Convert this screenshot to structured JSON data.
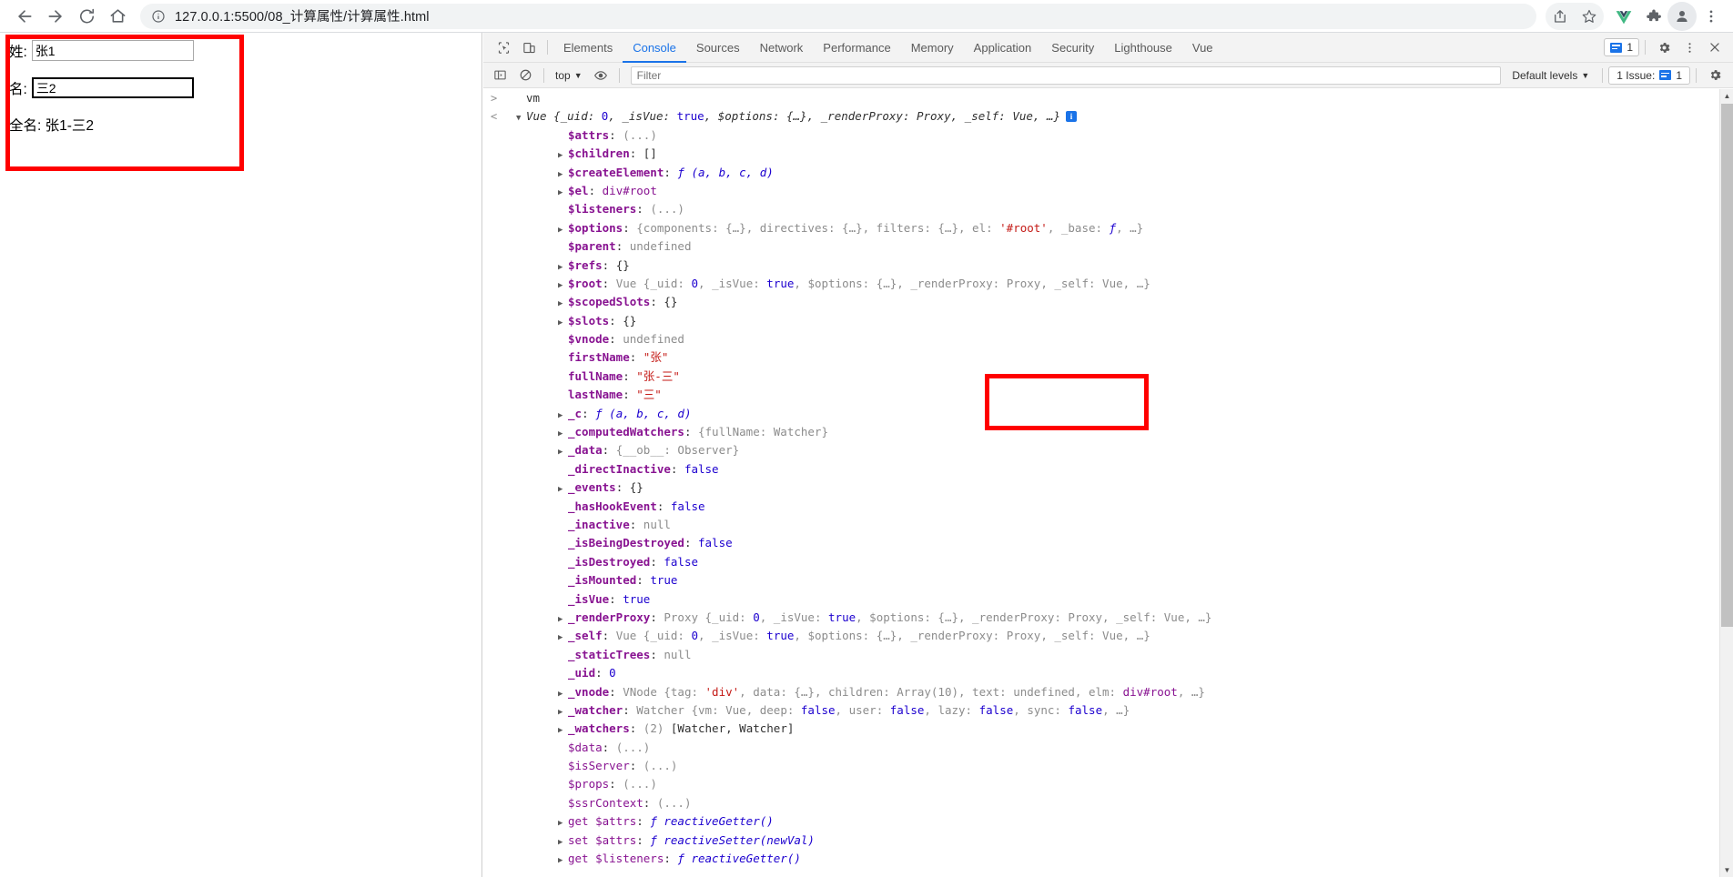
{
  "browser": {
    "nav": {
      "back": "back-arrow",
      "forward": "forward-arrow",
      "reload": "reload",
      "home": "home"
    },
    "omnibox": {
      "info_icon": "info-circle-icon",
      "url": "127.0.0.1:5500/08_计算属性/计算属性.html"
    },
    "actions": [
      "share-icon",
      "bookmark-star-icon"
    ],
    "extensions": [
      "vue-devtools-icon",
      "puzzle-extensions-icon",
      "profile-avatar-icon",
      "chrome-menu-icon"
    ]
  },
  "page": {
    "fields": [
      {
        "label": "姓:",
        "value": "张1",
        "focused": false
      },
      {
        "label": "名:",
        "value": "三2",
        "focused": true
      }
    ],
    "fullname_line": "全名: 张1-三2",
    "highlight_color": "#ff0000"
  },
  "devtools": {
    "toolbar_icons": [
      "inspect-element-icon",
      "device-toolbar-icon"
    ],
    "tabs": [
      {
        "label": "Elements",
        "active": false
      },
      {
        "label": "Console",
        "active": true
      },
      {
        "label": "Sources",
        "active": false
      },
      {
        "label": "Network",
        "active": false
      },
      {
        "label": "Performance",
        "active": false
      },
      {
        "label": "Memory",
        "active": false
      },
      {
        "label": "Application",
        "active": false
      },
      {
        "label": "Security",
        "active": false
      },
      {
        "label": "Lighthouse",
        "active": false
      },
      {
        "label": "Vue",
        "active": false
      }
    ],
    "issue_badge_count": "1",
    "settings_icon": "gear-icon",
    "more_icon": "kebab-menu-icon",
    "close_icon": "close-icon",
    "filterbar": {
      "sidebar_icon": "console-sidebar-icon",
      "clear_icon": "clear-console-icon",
      "context": "top",
      "eye_icon": "live-expression-eye-icon",
      "filter_placeholder": "Filter",
      "levels": "Default levels",
      "issues_label": "1 Issue:",
      "issues_count": "1",
      "console_settings_icon": "gear-icon"
    },
    "accent_color": "#1a73e8"
  },
  "console": {
    "input_echo": "vm",
    "highlight_color": "#ff0000",
    "lines": [
      {
        "id": "l0",
        "gutter": ">",
        "arrow": "",
        "indent": 0,
        "tokens": [
          {
            "t": "vm",
            "c": "k-plain"
          }
        ]
      },
      {
        "id": "l1",
        "gutter": "<",
        "arrow": "▼",
        "indent": 0,
        "tokens": [
          {
            "t": "Vue ",
            "c": "k-vueit"
          },
          {
            "t": "{_uid: ",
            "c": "k-obj"
          },
          {
            "t": "0",
            "c": "k-num"
          },
          {
            "t": ", _isVue: ",
            "c": "k-obj"
          },
          {
            "t": "true",
            "c": "k-bool"
          },
          {
            "t": ", $options: {…}, _renderProxy: Proxy, _self: Vue, …}",
            "c": "k-obj"
          }
        ],
        "info": true
      },
      {
        "id": "l2",
        "gutter": "",
        "arrow": "",
        "indent": 1,
        "tokens": [
          {
            "t": "$attrs",
            "c": "k-prop"
          },
          {
            "t": ": ",
            "c": "k-plain"
          },
          {
            "t": "(...)",
            "c": "k-grey"
          }
        ]
      },
      {
        "id": "l3",
        "gutter": "",
        "arrow": "▶",
        "indent": 1,
        "tokens": [
          {
            "t": "$children",
            "c": "k-prop"
          },
          {
            "t": ": []",
            "c": "k-plain"
          }
        ]
      },
      {
        "id": "l4",
        "gutter": "",
        "arrow": "▶",
        "indent": 1,
        "tokens": [
          {
            "t": "$createElement",
            "c": "k-prop"
          },
          {
            "t": ": ",
            "c": "k-plain"
          },
          {
            "t": "ƒ (a, b, c, d)",
            "c": "k-fn"
          }
        ]
      },
      {
        "id": "l5",
        "gutter": "",
        "arrow": "▶",
        "indent": 1,
        "tokens": [
          {
            "t": "$el",
            "c": "k-prop"
          },
          {
            "t": ": ",
            "c": "k-plain"
          },
          {
            "t": "div#root",
            "c": "k-node"
          }
        ]
      },
      {
        "id": "l6",
        "gutter": "",
        "arrow": "",
        "indent": 1,
        "tokens": [
          {
            "t": "$listeners",
            "c": "k-prop"
          },
          {
            "t": ": ",
            "c": "k-plain"
          },
          {
            "t": "(...)",
            "c": "k-grey"
          }
        ]
      },
      {
        "id": "l7",
        "gutter": "",
        "arrow": "▶",
        "indent": 1,
        "tokens": [
          {
            "t": "$options",
            "c": "k-prop"
          },
          {
            "t": ": ",
            "c": "k-plain"
          },
          {
            "t": "{components: {…}, directives: {…}, filters: {…}, el: ",
            "c": "k-grey"
          },
          {
            "t": "'#root'",
            "c": "k-str"
          },
          {
            "t": ", _base: ",
            "c": "k-grey"
          },
          {
            "t": "ƒ",
            "c": "k-fn"
          },
          {
            "t": ", …}",
            "c": "k-grey"
          }
        ]
      },
      {
        "id": "l8",
        "gutter": "",
        "arrow": "",
        "indent": 1,
        "tokens": [
          {
            "t": "$parent",
            "c": "k-prop"
          },
          {
            "t": ": ",
            "c": "k-plain"
          },
          {
            "t": "undefined",
            "c": "k-grey"
          }
        ]
      },
      {
        "id": "l9",
        "gutter": "",
        "arrow": "▶",
        "indent": 1,
        "tokens": [
          {
            "t": "$refs",
            "c": "k-prop"
          },
          {
            "t": ": {}",
            "c": "k-plain"
          }
        ]
      },
      {
        "id": "l10",
        "gutter": "",
        "arrow": "▶",
        "indent": 1,
        "tokens": [
          {
            "t": "$root",
            "c": "k-prop"
          },
          {
            "t": ": ",
            "c": "k-plain"
          },
          {
            "t": "Vue {_uid: ",
            "c": "k-grey"
          },
          {
            "t": "0",
            "c": "k-num"
          },
          {
            "t": ", _isVue: ",
            "c": "k-grey"
          },
          {
            "t": "true",
            "c": "k-bool"
          },
          {
            "t": ", $options: {…}, _renderProxy: Proxy, _self: Vue, …}",
            "c": "k-grey"
          }
        ]
      },
      {
        "id": "l11",
        "gutter": "",
        "arrow": "▶",
        "indent": 1,
        "tokens": [
          {
            "t": "$scopedSlots",
            "c": "k-prop"
          },
          {
            "t": ": {}",
            "c": "k-plain"
          }
        ]
      },
      {
        "id": "l12",
        "gutter": "",
        "arrow": "▶",
        "indent": 1,
        "tokens": [
          {
            "t": "$slots",
            "c": "k-prop"
          },
          {
            "t": ": {}",
            "c": "k-plain"
          }
        ]
      },
      {
        "id": "l13",
        "gutter": "",
        "arrow": "",
        "indent": 1,
        "tokens": [
          {
            "t": "$vnode",
            "c": "k-prop"
          },
          {
            "t": ": ",
            "c": "k-plain"
          },
          {
            "t": "undefined",
            "c": "k-grey"
          }
        ]
      },
      {
        "id": "l14",
        "gutter": "",
        "arrow": "",
        "indent": 1,
        "tokens": [
          {
            "t": "firstName",
            "c": "k-prop"
          },
          {
            "t": ": ",
            "c": "k-plain"
          },
          {
            "t": "\"张\"",
            "c": "k-str"
          }
        ]
      },
      {
        "id": "l15",
        "gutter": "",
        "arrow": "",
        "indent": 1,
        "tokens": [
          {
            "t": "fullName",
            "c": "k-prop"
          },
          {
            "t": ": ",
            "c": "k-plain"
          },
          {
            "t": "\"张-三\"",
            "c": "k-str"
          }
        ]
      },
      {
        "id": "l16",
        "gutter": "",
        "arrow": "",
        "indent": 1,
        "tokens": [
          {
            "t": "lastName",
            "c": "k-prop"
          },
          {
            "t": ": ",
            "c": "k-plain"
          },
          {
            "t": "\"三\"",
            "c": "k-str"
          }
        ]
      },
      {
        "id": "l17",
        "gutter": "",
        "arrow": "▶",
        "indent": 1,
        "tokens": [
          {
            "t": "_c",
            "c": "k-prop"
          },
          {
            "t": ": ",
            "c": "k-plain"
          },
          {
            "t": "ƒ (a, b, c, d)",
            "c": "k-fn"
          }
        ]
      },
      {
        "id": "l18",
        "gutter": "",
        "arrow": "▶",
        "indent": 1,
        "tokens": [
          {
            "t": "_computedWatchers",
            "c": "k-prop"
          },
          {
            "t": ": ",
            "c": "k-plain"
          },
          {
            "t": "{fullName: Watcher}",
            "c": "k-grey"
          }
        ]
      },
      {
        "id": "l19",
        "gutter": "",
        "arrow": "▶",
        "indent": 1,
        "tokens": [
          {
            "t": "_data",
            "c": "k-prop"
          },
          {
            "t": ": ",
            "c": "k-plain"
          },
          {
            "t": "{__ob__: Observer}",
            "c": "k-grey"
          }
        ]
      },
      {
        "id": "l20",
        "gutter": "",
        "arrow": "",
        "indent": 1,
        "tokens": [
          {
            "t": "_directInactive",
            "c": "k-prop"
          },
          {
            "t": ": ",
            "c": "k-plain"
          },
          {
            "t": "false",
            "c": "k-bool"
          }
        ]
      },
      {
        "id": "l21",
        "gutter": "",
        "arrow": "▶",
        "indent": 1,
        "tokens": [
          {
            "t": "_events",
            "c": "k-prop"
          },
          {
            "t": ": {}",
            "c": "k-plain"
          }
        ]
      },
      {
        "id": "l22",
        "gutter": "",
        "arrow": "",
        "indent": 1,
        "tokens": [
          {
            "t": "_hasHookEvent",
            "c": "k-prop"
          },
          {
            "t": ": ",
            "c": "k-plain"
          },
          {
            "t": "false",
            "c": "k-bool"
          }
        ]
      },
      {
        "id": "l23",
        "gutter": "",
        "arrow": "",
        "indent": 1,
        "tokens": [
          {
            "t": "_inactive",
            "c": "k-prop"
          },
          {
            "t": ": ",
            "c": "k-plain"
          },
          {
            "t": "null",
            "c": "k-grey"
          }
        ]
      },
      {
        "id": "l24",
        "gutter": "",
        "arrow": "",
        "indent": 1,
        "tokens": [
          {
            "t": "_isBeingDestroyed",
            "c": "k-prop"
          },
          {
            "t": ": ",
            "c": "k-plain"
          },
          {
            "t": "false",
            "c": "k-bool"
          }
        ]
      },
      {
        "id": "l25",
        "gutter": "",
        "arrow": "",
        "indent": 1,
        "tokens": [
          {
            "t": "_isDestroyed",
            "c": "k-prop"
          },
          {
            "t": ": ",
            "c": "k-plain"
          },
          {
            "t": "false",
            "c": "k-bool"
          }
        ]
      },
      {
        "id": "l26",
        "gutter": "",
        "arrow": "",
        "indent": 1,
        "tokens": [
          {
            "t": "_isMounted",
            "c": "k-prop"
          },
          {
            "t": ": ",
            "c": "k-plain"
          },
          {
            "t": "true",
            "c": "k-bool"
          }
        ]
      },
      {
        "id": "l27",
        "gutter": "",
        "arrow": "",
        "indent": 1,
        "tokens": [
          {
            "t": "_isVue",
            "c": "k-prop"
          },
          {
            "t": ": ",
            "c": "k-plain"
          },
          {
            "t": "true",
            "c": "k-bool"
          }
        ]
      },
      {
        "id": "l28",
        "gutter": "",
        "arrow": "▶",
        "indent": 1,
        "tokens": [
          {
            "t": "_renderProxy",
            "c": "k-prop"
          },
          {
            "t": ": ",
            "c": "k-plain"
          },
          {
            "t": "Proxy {_uid: ",
            "c": "k-grey"
          },
          {
            "t": "0",
            "c": "k-num"
          },
          {
            "t": ", _isVue: ",
            "c": "k-grey"
          },
          {
            "t": "true",
            "c": "k-bool"
          },
          {
            "t": ", $options: {…}, _renderProxy: Proxy, _self: Vue, …}",
            "c": "k-grey"
          }
        ]
      },
      {
        "id": "l29",
        "gutter": "",
        "arrow": "▶",
        "indent": 1,
        "tokens": [
          {
            "t": "_self",
            "c": "k-prop"
          },
          {
            "t": ": ",
            "c": "k-plain"
          },
          {
            "t": "Vue {_uid: ",
            "c": "k-grey"
          },
          {
            "t": "0",
            "c": "k-num"
          },
          {
            "t": ", _isVue: ",
            "c": "k-grey"
          },
          {
            "t": "true",
            "c": "k-bool"
          },
          {
            "t": ", $options: {…}, _renderProxy: Proxy, _self: Vue, …}",
            "c": "k-grey"
          }
        ]
      },
      {
        "id": "l30",
        "gutter": "",
        "arrow": "",
        "indent": 1,
        "tokens": [
          {
            "t": "_staticTrees",
            "c": "k-prop"
          },
          {
            "t": ": ",
            "c": "k-plain"
          },
          {
            "t": "null",
            "c": "k-grey"
          }
        ]
      },
      {
        "id": "l31",
        "gutter": "",
        "arrow": "",
        "indent": 1,
        "tokens": [
          {
            "t": "_uid",
            "c": "k-prop"
          },
          {
            "t": ": ",
            "c": "k-plain"
          },
          {
            "t": "0",
            "c": "k-num"
          }
        ]
      },
      {
        "id": "l32",
        "gutter": "",
        "arrow": "▶",
        "indent": 1,
        "tokens": [
          {
            "t": "_vnode",
            "c": "k-prop"
          },
          {
            "t": ": ",
            "c": "k-plain"
          },
          {
            "t": "VNode {tag: ",
            "c": "k-grey"
          },
          {
            "t": "'div'",
            "c": "k-str"
          },
          {
            "t": ", data: {…}, children: Array(10), text: undefined, elm: ",
            "c": "k-grey"
          },
          {
            "t": "div#root",
            "c": "k-node"
          },
          {
            "t": ", …}",
            "c": "k-grey"
          }
        ]
      },
      {
        "id": "l33",
        "gutter": "",
        "arrow": "▶",
        "indent": 1,
        "tokens": [
          {
            "t": "_watcher",
            "c": "k-prop"
          },
          {
            "t": ": ",
            "c": "k-plain"
          },
          {
            "t": "Watcher {vm: Vue, deep: ",
            "c": "k-grey"
          },
          {
            "t": "false",
            "c": "k-bool"
          },
          {
            "t": ", user: ",
            "c": "k-grey"
          },
          {
            "t": "false",
            "c": "k-bool"
          },
          {
            "t": ", lazy: ",
            "c": "k-grey"
          },
          {
            "t": "false",
            "c": "k-bool"
          },
          {
            "t": ", sync: ",
            "c": "k-grey"
          },
          {
            "t": "false",
            "c": "k-bool"
          },
          {
            "t": ", …}",
            "c": "k-grey"
          }
        ]
      },
      {
        "id": "l34",
        "gutter": "",
        "arrow": "▶",
        "indent": 1,
        "tokens": [
          {
            "t": "_watchers",
            "c": "k-prop"
          },
          {
            "t": ": ",
            "c": "k-plain"
          },
          {
            "t": "(2) ",
            "c": "k-grey"
          },
          {
            "t": "[Watcher, Watcher]",
            "c": "k-plain"
          }
        ]
      },
      {
        "id": "l35",
        "gutter": "",
        "arrow": "",
        "indent": 1,
        "tokens": [
          {
            "t": "$data",
            "c": "k-propl"
          },
          {
            "t": ": ",
            "c": "k-plain"
          },
          {
            "t": "(...)",
            "c": "k-grey"
          }
        ]
      },
      {
        "id": "l36",
        "gutter": "",
        "arrow": "",
        "indent": 1,
        "tokens": [
          {
            "t": "$isServer",
            "c": "k-propl"
          },
          {
            "t": ": ",
            "c": "k-plain"
          },
          {
            "t": "(...)",
            "c": "k-grey"
          }
        ]
      },
      {
        "id": "l37",
        "gutter": "",
        "arrow": "",
        "indent": 1,
        "tokens": [
          {
            "t": "$props",
            "c": "k-propl"
          },
          {
            "t": ": ",
            "c": "k-plain"
          },
          {
            "t": "(...)",
            "c": "k-grey"
          }
        ]
      },
      {
        "id": "l38",
        "gutter": "",
        "arrow": "",
        "indent": 1,
        "tokens": [
          {
            "t": "$ssrContext",
            "c": "k-propl"
          },
          {
            "t": ": ",
            "c": "k-plain"
          },
          {
            "t": "(...)",
            "c": "k-grey"
          }
        ]
      },
      {
        "id": "l39",
        "gutter": "",
        "arrow": "▶",
        "indent": 1,
        "tokens": [
          {
            "t": "get $attrs",
            "c": "k-propl"
          },
          {
            "t": ": ",
            "c": "k-plain"
          },
          {
            "t": "ƒ reactiveGetter()",
            "c": "k-fn"
          }
        ]
      },
      {
        "id": "l40",
        "gutter": "",
        "arrow": "▶",
        "indent": 1,
        "tokens": [
          {
            "t": "set $attrs",
            "c": "k-propl"
          },
          {
            "t": ": ",
            "c": "k-plain"
          },
          {
            "t": "ƒ reactiveSetter(newVal)",
            "c": "k-fn"
          }
        ]
      },
      {
        "id": "l41",
        "gutter": "",
        "arrow": "▶",
        "indent": 1,
        "tokens": [
          {
            "t": "get $listeners",
            "c": "k-propl"
          },
          {
            "t": ": ",
            "c": "k-plain"
          },
          {
            "t": "ƒ reactiveGetter()",
            "c": "k-fn"
          }
        ]
      }
    ]
  }
}
